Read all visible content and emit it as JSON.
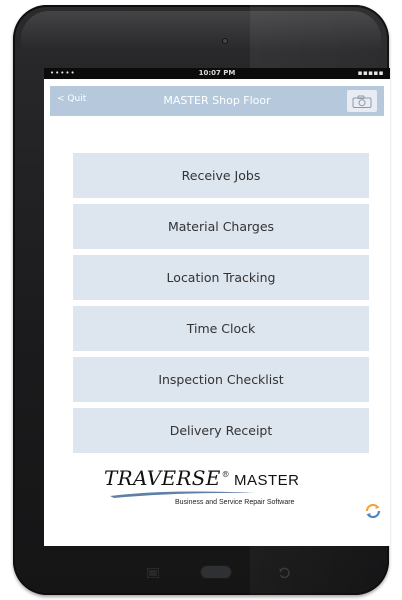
{
  "statusbar": {
    "signal": "•••••",
    "time": "10:07 PM",
    "battery": "▪▪▪▪▪"
  },
  "navbar": {
    "back_label": "< Quit",
    "title": "MASTER Shop Floor",
    "camera_icon": "camera-icon"
  },
  "menu": {
    "items": [
      {
        "label": "Receive Jobs"
      },
      {
        "label": "Material Charges"
      },
      {
        "label": "Location Tracking"
      },
      {
        "label": "Time Clock"
      },
      {
        "label": "Inspection Checklist"
      },
      {
        "label": "Delivery Receipt"
      }
    ]
  },
  "logo": {
    "brand": "TRAVERSE",
    "registered": "®",
    "product": "MASTER",
    "tagline": "Business and Service Repair Software"
  },
  "colors": {
    "navbar": "#b6c8dc",
    "menu_button": "#dde5ee",
    "menu_text": "#333333",
    "refresh_orange": "#f2a33a",
    "refresh_blue": "#4a84c4"
  },
  "icons": {
    "refresh": "refresh-icon",
    "hardware_menu": "menu-lines-icon",
    "hardware_home": "home-button",
    "hardware_back": "back-arrow-icon"
  }
}
